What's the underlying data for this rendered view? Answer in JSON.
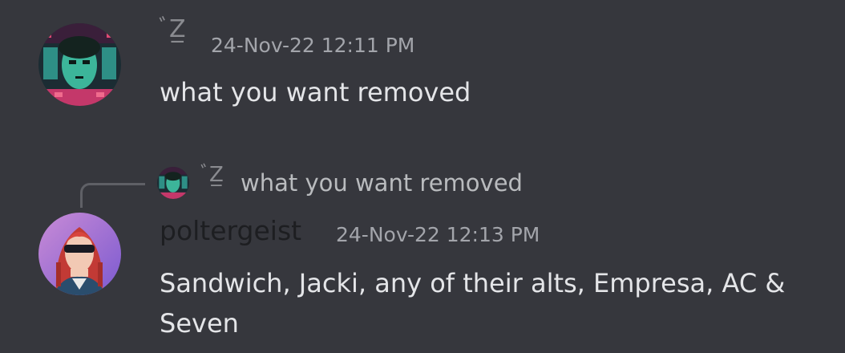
{
  "messages": [
    {
      "author": "",
      "author_glyph": "ﾞZ̲",
      "timestamp": "24-Nov-22 12:11 PM",
      "text": "what you want removed",
      "avatar": "cyber-green-face-avatar"
    },
    {
      "reply_to": {
        "author_glyph": "ﾞZ̲",
        "text": "what you want removed",
        "avatar": "cyber-green-face-avatar"
      },
      "author": "poltergeist",
      "timestamp": "24-Nov-22 12:13 PM",
      "text": "Sandwich, Jacki, any of their alts, Empresa, AC & Seven",
      "avatar": "red-hair-sunglasses-avatar"
    }
  ],
  "colors": {
    "background": "#36373d",
    "text": "#e4e5e8",
    "timestamp": "#a3a5ab",
    "username": "#1d1e21"
  }
}
